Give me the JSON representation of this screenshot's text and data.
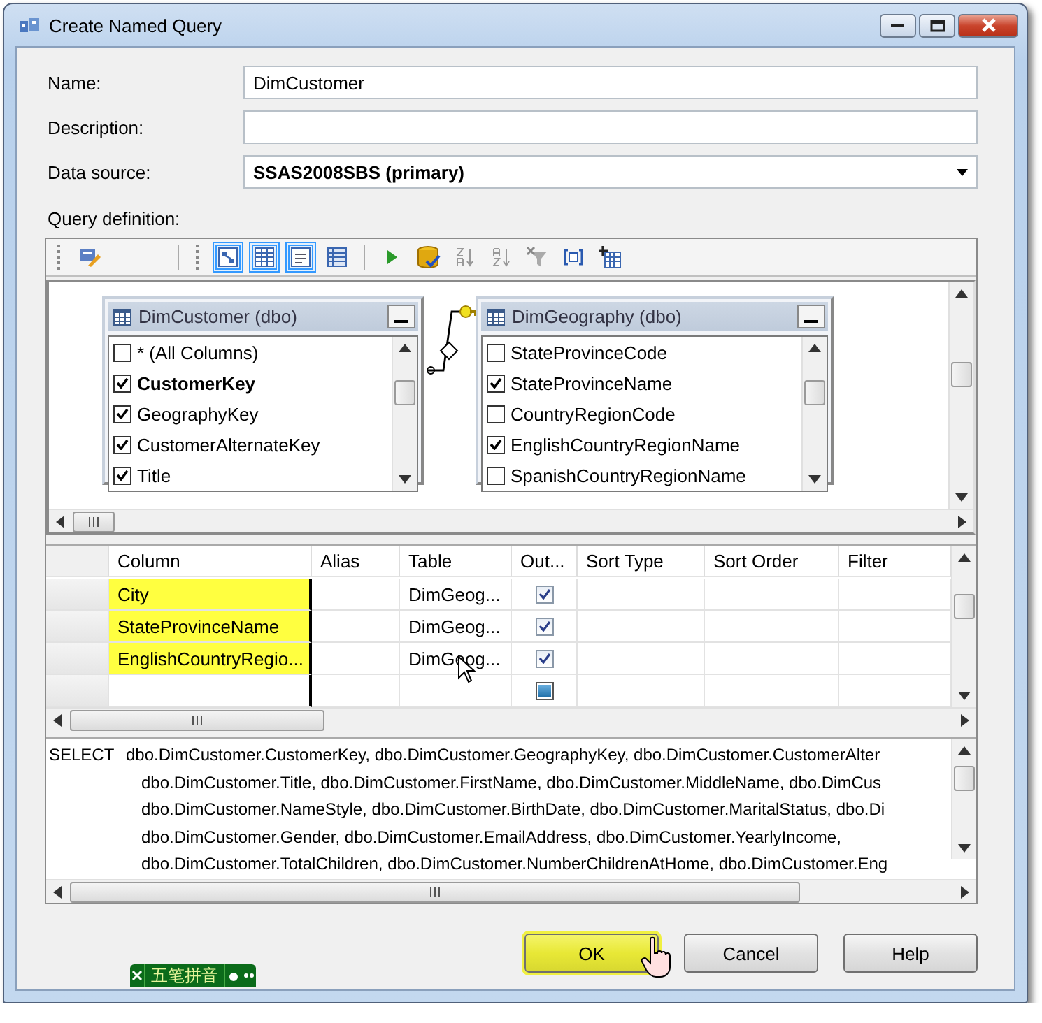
{
  "window": {
    "title": "Create Named Query"
  },
  "form": {
    "name_label": "Name:",
    "name_value": "DimCustomer",
    "description_label": "Description:",
    "data_source_label": "Data source:",
    "data_source_value": "SSAS2008SBS (primary)",
    "query_label": "Query definition:"
  },
  "toolbar": [
    [
      {
        "pressed": false
      }
    ],
    [
      {
        "pressed": true
      },
      {
        "pressed": true
      },
      {
        "pressed": true
      },
      {
        "pressed": false
      }
    ],
    [
      {
        "pressed": false
      },
      {
        "pressed": false
      },
      {
        "pressed": false
      },
      {
        "pressed": false
      },
      {
        "pressed": false
      },
      {
        "pressed": false
      },
      {
        "pressed": false
      }
    ]
  ],
  "diagram": {
    "tables": [
      {
        "title": "DimCustomer (dbo)",
        "columns": [
          {
            "label": "* (All Columns)",
            "checked": false,
            "key": false
          },
          {
            "label": "CustomerKey",
            "checked": true,
            "key": true
          },
          {
            "label": "GeographyKey",
            "checked": true,
            "key": false
          },
          {
            "label": "CustomerAlternateKey",
            "checked": true,
            "key": false
          },
          {
            "label": "Title",
            "checked": true,
            "key": false
          }
        ]
      },
      {
        "title": "DimGeography (dbo)",
        "columns": [
          {
            "label": "StateProvinceCode",
            "checked": false,
            "key": false
          },
          {
            "label": "StateProvinceName",
            "checked": true,
            "key": false
          },
          {
            "label": "CountryRegionCode",
            "checked": false,
            "key": false
          },
          {
            "label": "EnglishCountryRegionName",
            "checked": true,
            "key": false
          },
          {
            "label": "SpanishCountryRegionName",
            "checked": false,
            "key": false
          }
        ]
      }
    ]
  },
  "grid": {
    "columns": [
      "Column",
      "Alias",
      "Table",
      "Out...",
      "Sort Type",
      "Sort Order",
      "Filter"
    ],
    "rows": [
      {
        "kind": "field",
        "column": "City",
        "table": "DimGeog...",
        "output": true,
        "highlighted": true
      },
      {
        "kind": "field",
        "column": "StateProvinceName",
        "table": "DimGeog...",
        "output": true,
        "highlighted": true
      },
      {
        "kind": "field",
        "column": "EnglishCountryRegio...",
        "table": "DimGeog...",
        "output": true,
        "highlighted": true
      },
      {
        "kind": "new"
      }
    ]
  },
  "sql": {
    "keyword": "SELECT",
    "lines": [
      "dbo.DimCustomer.CustomerKey, dbo.DimCustomer.GeographyKey, dbo.DimCustomer.CustomerAlter",
      "dbo.DimCustomer.Title, dbo.DimCustomer.FirstName, dbo.DimCustomer.MiddleName, dbo.DimCus",
      "dbo.DimCustomer.NameStyle, dbo.DimCustomer.BirthDate, dbo.DimCustomer.MaritalStatus, dbo.Di",
      "dbo.DimCustomer.Gender, dbo.DimCustomer.EmailAddress, dbo.DimCustomer.YearlyIncome,",
      "dbo.DimCustomer.TotalChildren, dbo.DimCustomer.NumberChildrenAtHome, dbo.DimCustomer.Eng"
    ]
  },
  "buttons": [
    {
      "label": "OK",
      "highlighted": true
    },
    {
      "label": "Cancel",
      "highlighted": false
    },
    {
      "label": "Help",
      "highlighted": false
    }
  ],
  "ime_bar": {
    "label": "五笔拼音"
  }
}
